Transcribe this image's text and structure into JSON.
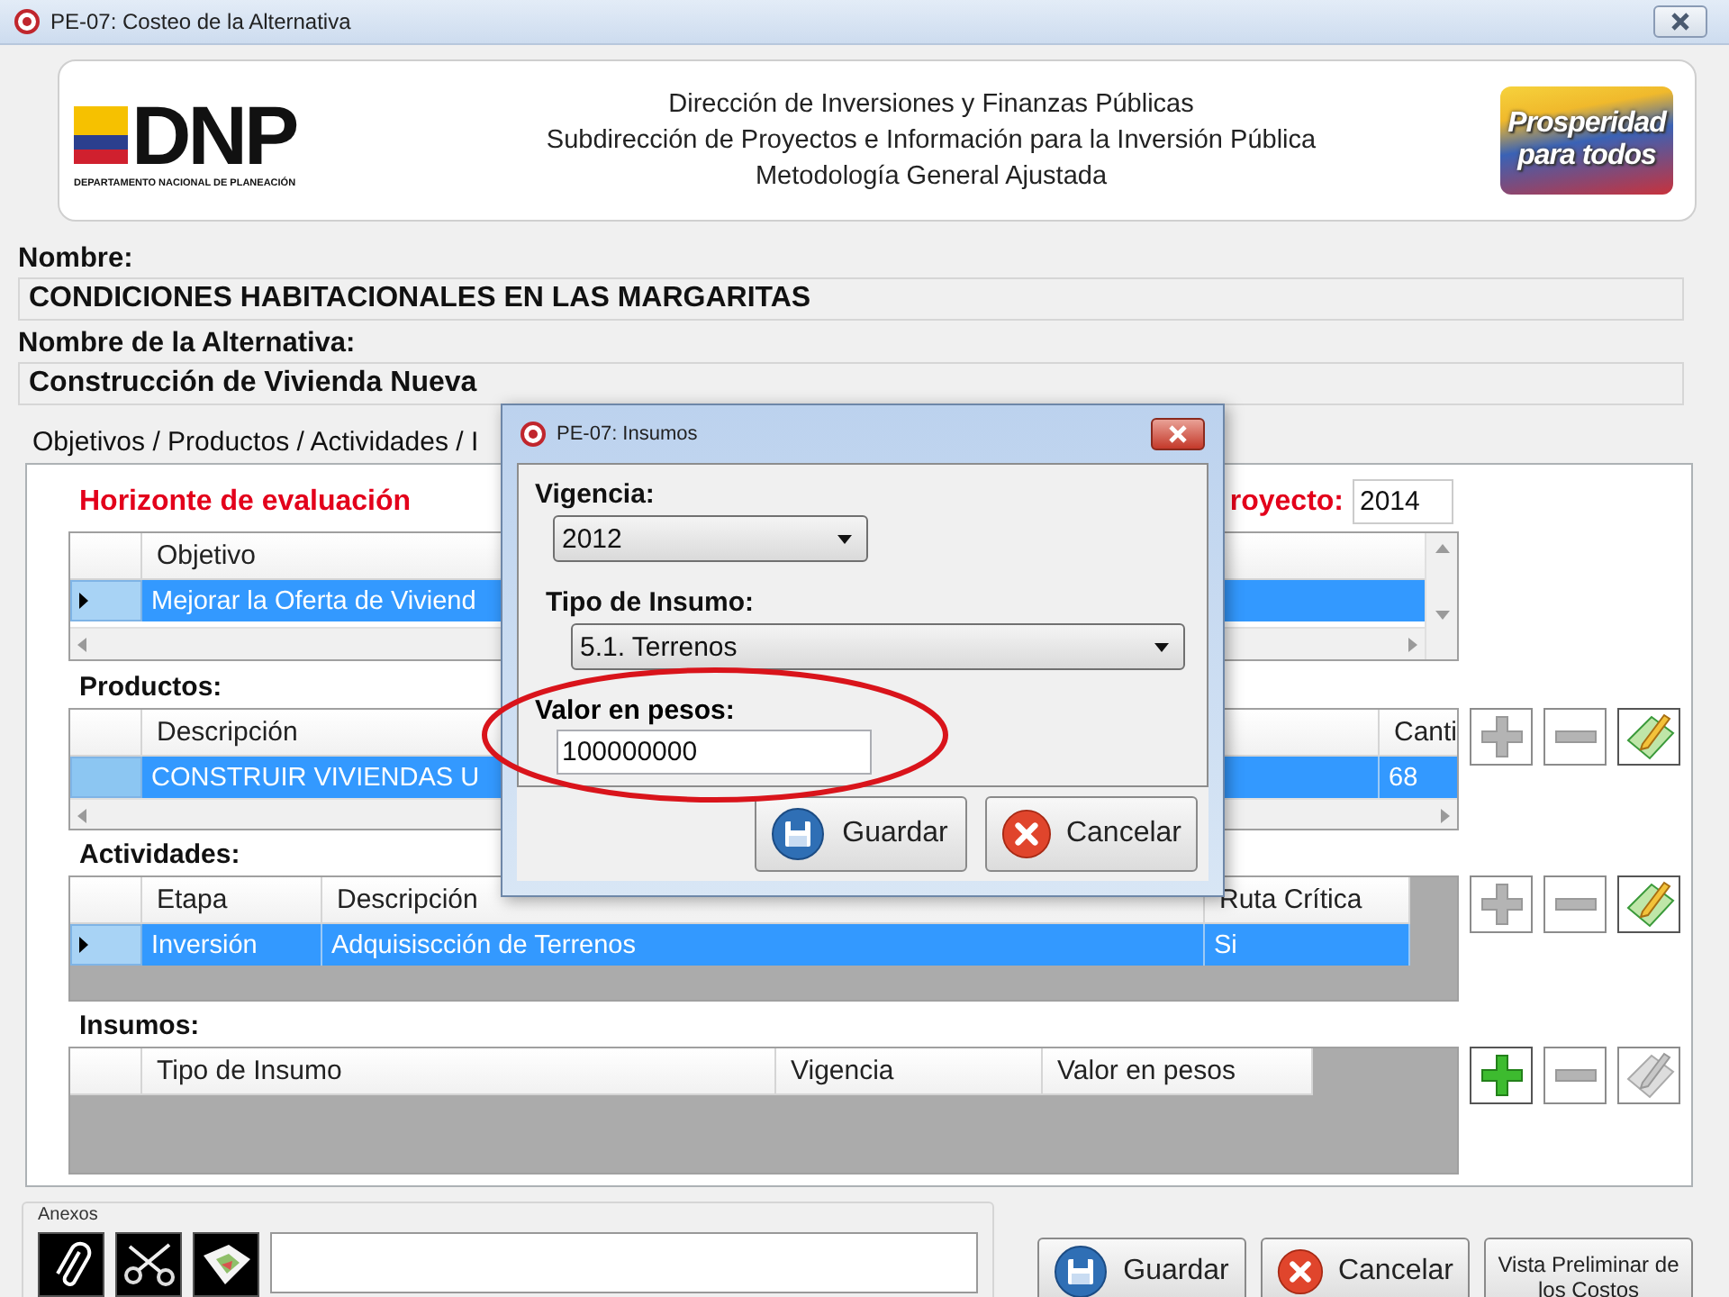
{
  "window": {
    "title": "PE-07: Costeo de la Alternativa"
  },
  "header": {
    "logo": {
      "mark": "DNP",
      "caption": "DEPARTAMENTO NACIONAL DE PLANEACIÓN"
    },
    "lines": [
      "Dirección de Inversiones y Finanzas Públicas",
      "Subdirección de Proyectos e Información para la Inversión Pública",
      "Metodología General Ajustada"
    ],
    "slogan": [
      "Prosperidad",
      "para todos"
    ]
  },
  "fields": [
    {
      "label": "Nombre:",
      "value": "CONDICIONES HABITACIONALES EN LAS MARGARITAS"
    },
    {
      "label": "Nombre de la Alternativa:",
      "value": "Construcción de Vivienda Nueva"
    }
  ],
  "tab": {
    "label": "Objetivos / Productos / Actividades / I"
  },
  "horizon": {
    "title": "Horizonte de evaluación",
    "year_label": "royecto:",
    "year_value": "2014"
  },
  "grids": [
    {
      "kind": "objectives",
      "columns": [
        "Objetivo"
      ],
      "rows": [
        {
          "cells": [
            "Mejorar la Oferta de Viviend"
          ],
          "selected": true,
          "current": true
        }
      ]
    },
    {
      "kind": "products",
      "label": "Productos:",
      "columns": [
        "Descripción",
        "Canti"
      ],
      "rows": [
        {
          "cells": [
            "CONSTRUIR VIVIENDAS U",
            "68"
          ],
          "selected": true,
          "current": false
        }
      ],
      "actions": [
        {
          "kind": "add",
          "disabled": true
        },
        {
          "kind": "remove",
          "disabled": true
        },
        {
          "kind": "edit",
          "disabled": false
        }
      ]
    },
    {
      "kind": "activities",
      "label": "Actividades:",
      "columns": [
        "Etapa",
        "Descripción",
        "Ruta Crítica"
      ],
      "rows": [
        {
          "cells": [
            "Inversión",
            "Adquisiscción de Terrenos",
            "Si"
          ],
          "selected": true,
          "current": true
        }
      ],
      "actions": [
        {
          "kind": "add",
          "disabled": true
        },
        {
          "kind": "remove",
          "disabled": true
        },
        {
          "kind": "edit",
          "disabled": false
        }
      ]
    },
    {
      "kind": "inputs",
      "label": "Insumos:",
      "columns": [
        "Tipo de Insumo",
        "Vigencia",
        "Valor en pesos"
      ],
      "actions": [
        {
          "kind": "add",
          "disabled": false
        },
        {
          "kind": "remove",
          "disabled": true
        },
        {
          "kind": "edit",
          "disabled": true
        }
      ]
    }
  ],
  "bottom": {
    "attachments": {
      "label": "Anexos",
      "tools": [
        {
          "kind": "attach"
        },
        {
          "kind": "cut"
        },
        {
          "kind": "image"
        }
      ]
    },
    "buttons": [
      {
        "kind": "save",
        "label": "Guardar"
      },
      {
        "kind": "cancel",
        "label": "Cancelar"
      },
      {
        "kind": "preview",
        "label": "Vista Preliminar de los Costos"
      }
    ]
  },
  "dialog": {
    "title": "PE-07: Insumos",
    "fields": [
      {
        "kind": "select",
        "label": "Vigencia:",
        "value": "2012",
        "highlighted": false
      },
      {
        "kind": "select",
        "label": "Tipo de Insumo:",
        "value": "5.1. Terrenos",
        "highlighted": false
      },
      {
        "kind": "input",
        "label": "Valor en pesos:",
        "value": "100000000",
        "highlighted": true
      }
    ],
    "buttons": [
      {
        "kind": "save",
        "label": "Guardar"
      },
      {
        "kind": "cancel",
        "label": "Cancelar"
      }
    ]
  }
}
